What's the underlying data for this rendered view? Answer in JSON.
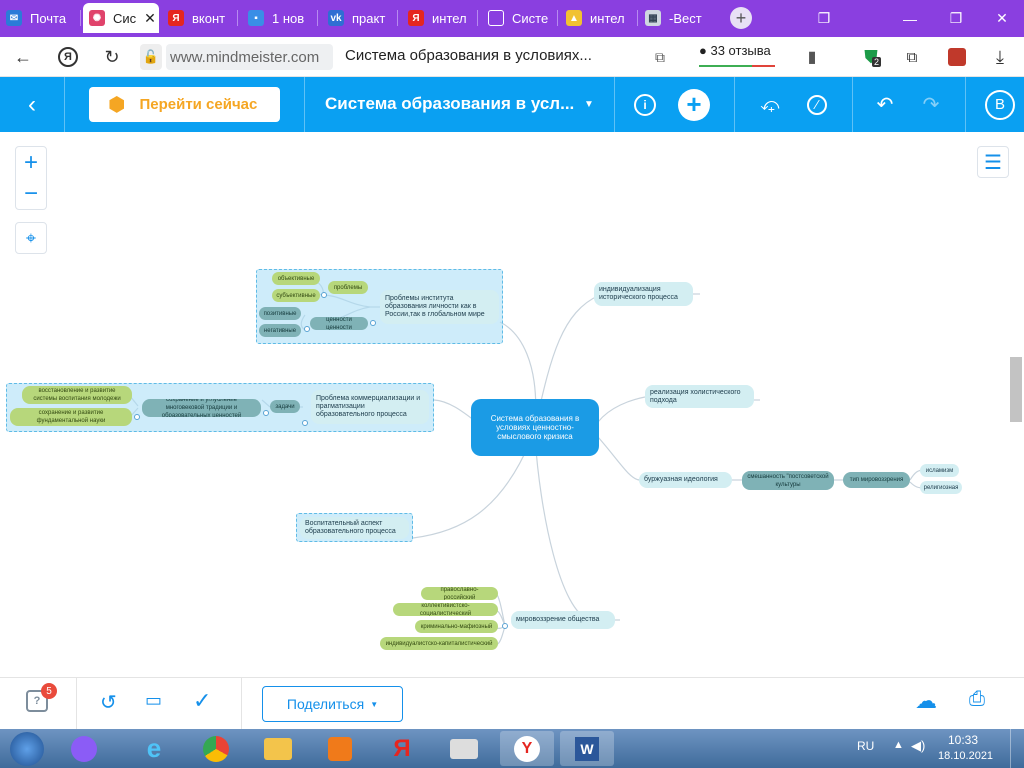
{
  "tabs": [
    {
      "label": "Почта",
      "icon": "mail-icon",
      "color": "#2b7bd8"
    },
    {
      "label": "Сис",
      "icon": "mindmeister-icon",
      "color": "#e0436b",
      "active": true
    },
    {
      "label": "вконт",
      "icon": "yandex-icon",
      "color": "#e52620"
    },
    {
      "label": "1 нов",
      "icon": "chat-icon",
      "color": "#3a8ee6"
    },
    {
      "label": "практ",
      "icon": "vk-icon",
      "color": "#2f6ed3"
    },
    {
      "label": "интел",
      "icon": "yandex-icon",
      "color": "#e52620"
    },
    {
      "label": "Систе",
      "icon": "document-icon",
      "color": "#ffffff"
    },
    {
      "label": "интел",
      "icon": "image-icon",
      "color": "#f1c232"
    },
    {
      "label": "-Вест",
      "icon": "site-icon",
      "color": "#cfd8e0"
    }
  ],
  "address": {
    "domain": "www.mindmeister.com",
    "page_title": "Система образования в условиях...",
    "reviews": "33 отзыва",
    "shield_badge": "2"
  },
  "toolbar": {
    "go_now": "Перейти сейчас",
    "map_title": "Система образования в усл...",
    "avatar_letter": "B"
  },
  "mindmap": {
    "root": "Система образования в условиях ценностно-смыслового кризиса",
    "right_nodes": [
      "индивидуализация исторического процесса",
      "реализация холистического подхода",
      "буржуазная идеология",
      "мировоззрение общества"
    ],
    "ideology_children": {
      "first": "смешанность \"постсоветской культуры",
      "second": "тип мировоззрения",
      "leaves": [
        "исламизм",
        "религиозная"
      ]
    },
    "worldview_children": [
      "православно-российский",
      "коллективистско-социалистический",
      "криминально-мафиозный",
      "индивидуалистско-капиталистический"
    ],
    "left_top": {
      "main": "Проблемы института образования личности как в России,так в глобальном мире",
      "problems": "проблемы",
      "objective": "объективные",
      "subjective": "субъективные",
      "values": "ценности ценности",
      "positive": "позитивные",
      "negative": "негативные"
    },
    "left_mid": {
      "main": "Проблема коммерциализации и прагматизации образовательного процесса",
      "tasks": "задачи",
      "preserve": "сохранение и углубление многовековой традиции и образовательных ценностей",
      "restore": "восстановление и развитие системы воспитания молодежи",
      "science": "сохранение и развитие фундаментальной науки"
    },
    "left_bottom": "Воспитательный аспект образовательного процесса"
  },
  "bottom": {
    "help_badge": "5",
    "share": "Поделиться"
  },
  "taskbar": {
    "lang": "RU",
    "time": "10:33",
    "date": "18.10.2021"
  }
}
